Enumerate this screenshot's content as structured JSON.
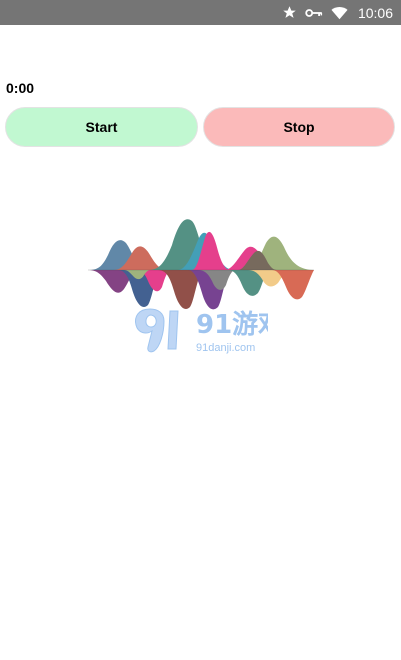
{
  "status_bar": {
    "time": "10:06",
    "icons": [
      "star-icon",
      "key-icon",
      "wifi-icon"
    ],
    "background": "#757575"
  },
  "timer": {
    "value": "0:00"
  },
  "controls": {
    "start_label": "Start",
    "start_color": "#c1f8d1",
    "stop_label": "Stop",
    "stop_color": "#fbbaba"
  },
  "watermark": {
    "logo_text": "91游戏",
    "url_text": "91danji.com"
  }
}
